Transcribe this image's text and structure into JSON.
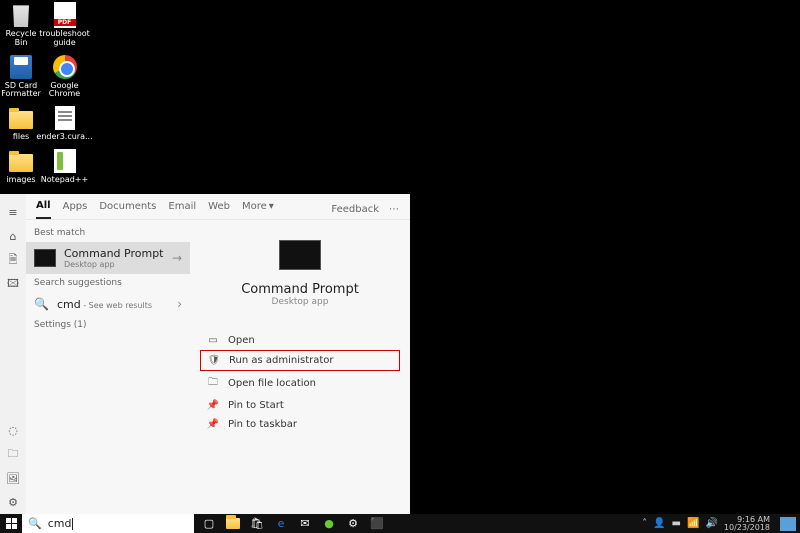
{
  "desktop": {
    "icons": [
      {
        "name": "recycle-bin",
        "label": "Recycle Bin"
      },
      {
        "name": "troubleshoot",
        "label": "troubleshoot guide"
      },
      {
        "name": "sd-card",
        "label": "SD Card Formatter"
      },
      {
        "name": "chrome",
        "label": "Google Chrome"
      },
      {
        "name": "files",
        "label": "files"
      },
      {
        "name": "ender",
        "label": "ender3.cura..."
      },
      {
        "name": "images",
        "label": "images"
      },
      {
        "name": "notepad",
        "label": "Notepad++"
      }
    ]
  },
  "start": {
    "tabs": [
      "All",
      "Apps",
      "Documents",
      "Email",
      "Web",
      "More"
    ],
    "feedback": "Feedback",
    "sections": {
      "best_match": "Best match",
      "search_suggestions": "Search suggestions",
      "settings": "Settings (1)"
    },
    "best_match_item": {
      "title": "Command Prompt",
      "subtitle": "Desktop app"
    },
    "suggestion": {
      "query": "cmd",
      "hint": " - See web results"
    },
    "preview": {
      "title": "Command Prompt",
      "subtitle": "Desktop app"
    },
    "actions": [
      "Open",
      "Run as administrator",
      "Open file location",
      "Pin to Start",
      "Pin to taskbar"
    ]
  },
  "search_value": "cmd",
  "tray": {
    "time": "9:16 AM",
    "date": "10/23/2018"
  }
}
